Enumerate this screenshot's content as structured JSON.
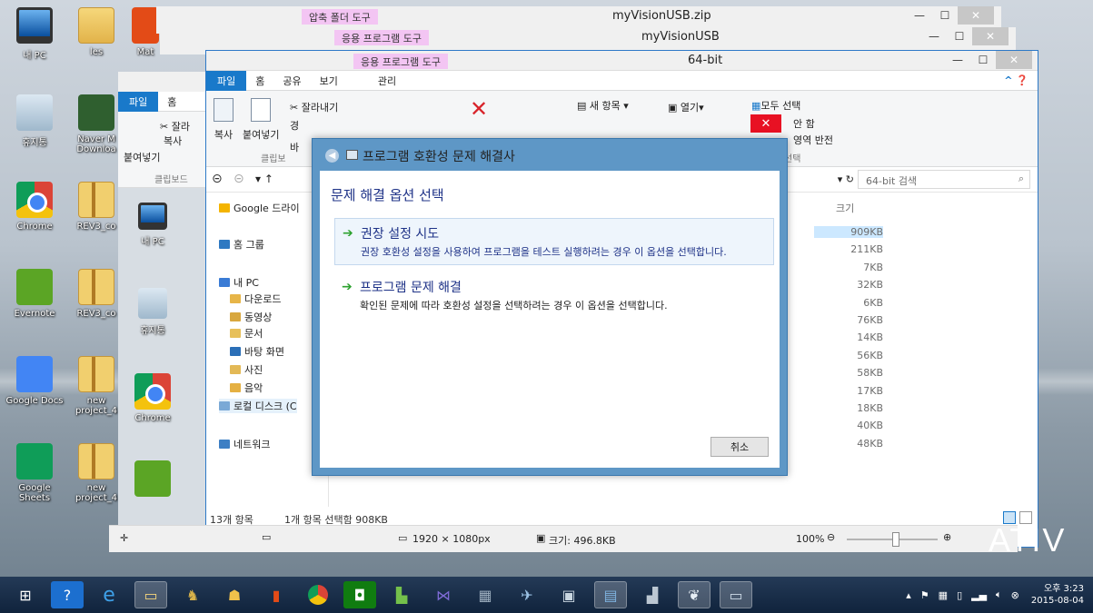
{
  "desktop": {
    "icons_col1": [
      {
        "label": "내 PC",
        "kind": "pc-icon"
      },
      {
        "label": "휴지통",
        "kind": "recycle-bin-icon"
      },
      {
        "label": "Chrome",
        "kind": "chrome-icon"
      },
      {
        "label": "Evernote",
        "kind": "evernote-icon"
      },
      {
        "label": "Google Docs",
        "kind": "google-docs-icon"
      },
      {
        "label": "Google Sheets",
        "kind": "google-sheets-icon"
      }
    ],
    "icons_col2": [
      {
        "label": "les",
        "kind": "folder-icon"
      },
      {
        "label": "Naver M Downloa",
        "kind": "video-icon"
      },
      {
        "label": "REV3_co",
        "kind": "zip-folder-icon"
      },
      {
        "label": "REV3_co",
        "kind": "zip-folder-icon"
      },
      {
        "label": "new project_4",
        "kind": "zip-folder-icon"
      },
      {
        "label": "new project_4",
        "kind": "zip-folder-icon"
      }
    ],
    "icons_col3_partial": [
      {
        "label": "Mat",
        "kind": "office-icon"
      }
    ],
    "inner_icons": [
      {
        "label": "내 PC"
      },
      {
        "label": "휴지통"
      },
      {
        "label": "Chrome"
      },
      {
        "label": ""
      }
    ],
    "watermark": "ATIV"
  },
  "windows": {
    "zip": {
      "context_tab": "압축 폴더 도구",
      "title": "myVisionUSB.zip"
    },
    "usb": {
      "context_tab": "응용 프로그램 도구",
      "title": "myVisionUSB"
    },
    "bit": {
      "context_tab": "응용 프로그램 도구",
      "title": "64-bit"
    }
  },
  "ribbon_tabs_back": [
    "파일",
    "홈"
  ],
  "ribbon_tabs": [
    "파일",
    "홈",
    "공유",
    "보기",
    "관리"
  ],
  "ribbon": {
    "cut": "잘라내기",
    "copy": "복사",
    "paste": "붙여넣기",
    "new_item": "새 항목",
    "open": "열기",
    "select_all": "모두 선택",
    "select_none": "안 함",
    "invert": "영역 반전",
    "clipboard_group": "클립보드",
    "select_group": "선택",
    "back_cut": "잘라",
    "back_copy": "복사",
    "back_paste": "붙여넣기",
    "back_group": "클립보드",
    "mid_clip": "클립보",
    "link_fragment": "경",
    "frag_b": "바"
  },
  "navbar": {
    "search_placeholder": "64-bit 검색"
  },
  "tree": [
    {
      "label": "Google 드라이",
      "color": "#f4b400"
    },
    {
      "label": "홈 그룹",
      "color": "#2e79c2"
    },
    {
      "label": "내 PC",
      "color": "#3a7bd5"
    },
    {
      "label": "다운로드",
      "color": "#e7b548"
    },
    {
      "label": "동영상",
      "color": "#d8a73e"
    },
    {
      "label": "문서",
      "color": "#e7c05a"
    },
    {
      "label": "바탕 화면",
      "color": "#2b6fb7"
    },
    {
      "label": "사진",
      "color": "#e3b956"
    },
    {
      "label": "음악",
      "color": "#e5b042"
    },
    {
      "label": "로컬 디스크 (C",
      "color": "#7aa9d6"
    },
    {
      "label": "네트워크",
      "color": "#3d7fc4"
    }
  ],
  "size_header": "크기",
  "sizes": [
    "909KB",
    "211KB",
    "7KB",
    "32KB",
    "6KB",
    "76KB",
    "14KB",
    "56KB",
    "58KB",
    "17KB",
    "18KB",
    "40KB",
    "48KB"
  ],
  "status": {
    "count": "13개 항목",
    "selected": "1개 항목 선택함 908KB"
  },
  "bottom": {
    "dimensions": "1920 × 1080px",
    "size": "크기: 496.8KB",
    "zoom": "100%"
  },
  "dialog": {
    "window_title": "프로그램 호환성 문제 해결사",
    "heading": "문제 해결 옵션 선택",
    "options": [
      {
        "title": "권장 설정 시도",
        "desc": "권장 호환성 설정을 사용하여 프로그램을 테스트 실행하려는 경우 이 옵션을 선택합니다."
      },
      {
        "title": "프로그램 문제 해결",
        "desc": "확인된 문제에 따라 호환성 설정을 선택하려는 경우 이 옵션을 선택합니다."
      }
    ],
    "cancel": "취소"
  },
  "tray": {
    "time": "오후 3:23",
    "date": "2015-08-04"
  }
}
